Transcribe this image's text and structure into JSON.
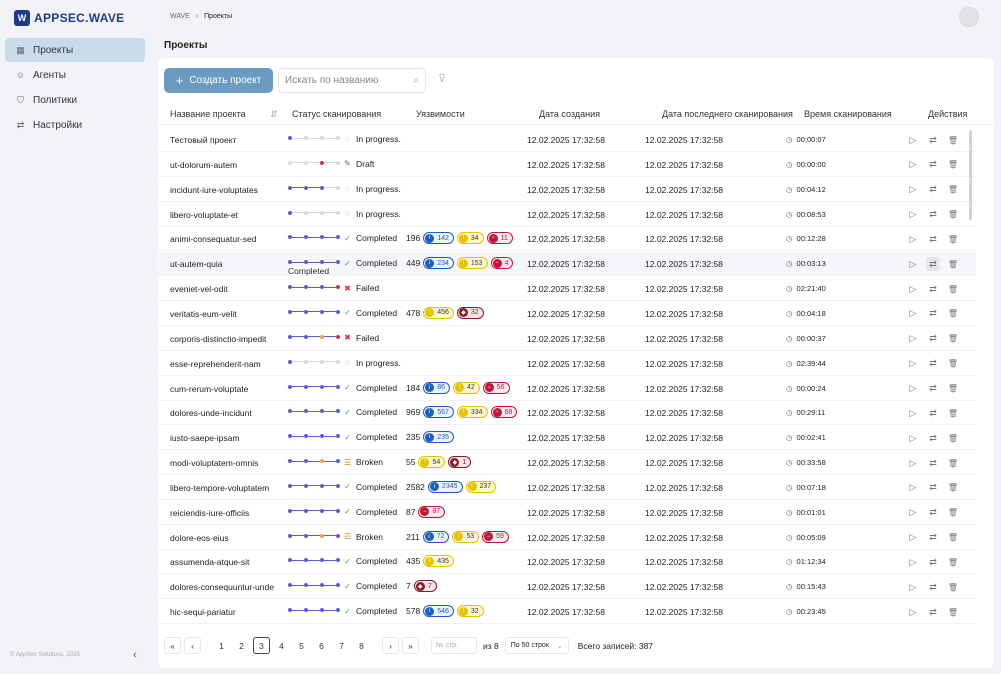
{
  "app": {
    "logo_mark": "W",
    "logo_text": "APPSEC.WAVE"
  },
  "sidebar": {
    "items": [
      {
        "label": "Проекты",
        "icon": "grid-icon",
        "glyph": "▦"
      },
      {
        "label": "Агенты",
        "icon": "agent-icon",
        "glyph": "☺"
      },
      {
        "label": "Политики",
        "icon": "shield-icon",
        "glyph": "⛉"
      },
      {
        "label": "Настройки",
        "icon": "sliders-icon",
        "glyph": "⇄"
      }
    ],
    "copyright": "© AppSec Solutions, 2025",
    "collapse_glyph": "‹"
  },
  "breadcrumb": {
    "root": "WAVE",
    "separator": "›",
    "current": "Проекты"
  },
  "page_title": "Проекты",
  "toolbar": {
    "create_label": "Создать проект",
    "create_glyph": "+",
    "search_placeholder": "Искать по названию",
    "search_glyph": "⌕",
    "filter_glyph": "⊽"
  },
  "table": {
    "headers": {
      "name": "Название проекта",
      "sort_glyph": "⇵",
      "status": "Статус сканирования",
      "vulns": "Уязвимости",
      "created": "Дата создания",
      "last_scan": "Дата последнего сканирования",
      "scan_time": "Время сканирования",
      "actions": "Действия"
    },
    "rows": [
      {
        "name": "Тестовый проект",
        "pipe": [
          "b",
          "g",
          "g",
          "g"
        ],
        "status": "In progress.",
        "kind": "progress",
        "count": "",
        "badges": [],
        "created": "12.02.2025 17:32:58",
        "last": "12.02.2025 17:32:58",
        "time": "00:00:07"
      },
      {
        "name": "ut-dolorum-autem",
        "pipe": [
          "g",
          "g",
          "r",
          "g"
        ],
        "status": "Draft",
        "kind": "draft",
        "count": "",
        "badges": [],
        "created": "12.02.2025 17:32:58",
        "last": "12.02.2025 17:32:58",
        "time": "00:00:00"
      },
      {
        "name": "incidunt-iure-voluptates",
        "pipe": [
          "b",
          "b",
          "b",
          "g"
        ],
        "status": "In progress.",
        "kind": "progress",
        "count": "",
        "badges": [],
        "created": "12.02.2025 17:32:58",
        "last": "12.02.2025 17:32:58",
        "time": "00:04:12"
      },
      {
        "name": "libero-voluptate-et",
        "pipe": [
          "b",
          "g",
          "g",
          "g"
        ],
        "status": "In progress.",
        "kind": "progress",
        "count": "",
        "badges": [],
        "created": "12.02.2025 17:32:58",
        "last": "12.02.2025 17:32:58",
        "time": "00:08:53"
      },
      {
        "name": "animi-consequatur-sed",
        "pipe": [
          "b",
          "b",
          "b",
          "b"
        ],
        "status": "Completed",
        "kind": "ok",
        "count": "196",
        "badges": [
          {
            "t": "info",
            "v": "142"
          },
          {
            "t": "warn",
            "v": "34"
          },
          {
            "t": "crit",
            "v": "11"
          }
        ],
        "created": "12.02.2025 17:32:58",
        "last": "12.02.2025 17:32:58",
        "time": "00:12:28"
      },
      {
        "name": "ut-autem-quia",
        "pipe": [
          "b",
          "b",
          "b",
          "b"
        ],
        "status": "Completed",
        "kind": "ok",
        "count": "449",
        "badges": [
          {
            "t": "info",
            "v": "234"
          },
          {
            "t": "warn",
            "v": "153"
          },
          {
            "t": "crit",
            "v": "4"
          }
        ],
        "created": "12.02.2025 17:32:58",
        "last": "12.02.2025 17:32:58",
        "time": "00:03:13",
        "hl": true
      },
      {
        "name": "eveniet-vel-odit",
        "pipe": [
          "b",
          "b",
          "b",
          "r"
        ],
        "status": "Failed",
        "kind": "fail",
        "count": "",
        "badges": [],
        "created": "12.02.2025 17:32:58",
        "last": "12.02.2025 17:32:58",
        "time": "02:21:40"
      },
      {
        "name": "veritatis-eum-velit",
        "pipe": [
          "b",
          "b",
          "b",
          "b"
        ],
        "status": "Completed",
        "kind": "ok",
        "count": "478",
        "badges": [
          {
            "t": "warn",
            "v": "456"
          },
          {
            "t": "high",
            "v": "32"
          }
        ],
        "created": "12.02.2025 17:32:58",
        "last": "12.02.2025 17:32:58",
        "time": "00:04:18"
      },
      {
        "name": "corporis-distinctio-impedit",
        "pipe": [
          "b",
          "b",
          "o",
          "r"
        ],
        "status": "Failed",
        "kind": "fail",
        "count": "",
        "badges": [],
        "created": "12.02.2025 17:32:58",
        "last": "12.02.2025 17:32:58",
        "time": "00:00:37"
      },
      {
        "name": "esse-reprehenderit-nam",
        "pipe": [
          "b",
          "g",
          "g",
          "g"
        ],
        "status": "In progress.",
        "kind": "progress",
        "count": "",
        "badges": [],
        "created": "12.02.2025 17:32:58",
        "last": "12.02.2025 17:32:58",
        "time": "02:39:44"
      },
      {
        "name": "cum-rerum-voluptate",
        "pipe": [
          "b",
          "b",
          "b",
          "b"
        ],
        "status": "Completed",
        "kind": "ok",
        "count": "184",
        "badges": [
          {
            "t": "info",
            "v": "86"
          },
          {
            "t": "warn",
            "v": "42"
          },
          {
            "t": "crit",
            "v": "56"
          }
        ],
        "created": "12.02.2025 17:32:58",
        "last": "12.02.2025 17:32:58",
        "time": "00:00:24"
      },
      {
        "name": "dolores-unde-incidunt",
        "pipe": [
          "b",
          "b",
          "b",
          "b"
        ],
        "status": "Completed",
        "kind": "ok",
        "count": "969",
        "badges": [
          {
            "t": "info",
            "v": "567"
          },
          {
            "t": "warn",
            "v": "334"
          },
          {
            "t": "crit",
            "v": "68"
          }
        ],
        "created": "12.02.2025 17:32:58",
        "last": "12.02.2025 17:32:58",
        "time": "00:29:11"
      },
      {
        "name": "iusto-saepe-ipsam",
        "pipe": [
          "b",
          "b",
          "b",
          "b"
        ],
        "status": "Completed",
        "kind": "ok",
        "count": "235",
        "badges": [
          {
            "t": "info",
            "v": "235"
          }
        ],
        "created": "12.02.2025 17:32:58",
        "last": "12.02.2025 17:32:58",
        "time": "00:02:41"
      },
      {
        "name": "modi-voluptatem-omnis",
        "pipe": [
          "b",
          "b",
          "o",
          "b"
        ],
        "status": "Broken",
        "kind": "broken",
        "count": "55",
        "badges": [
          {
            "t": "warn",
            "v": "54"
          },
          {
            "t": "high",
            "v": "1"
          }
        ],
        "created": "12.02.2025 17:32:58",
        "last": "12.02.2025 17:32:58",
        "time": "00:33:58"
      },
      {
        "name": "libero-tempore-voluptatem",
        "pipe": [
          "b",
          "b",
          "b",
          "b"
        ],
        "status": "Completed",
        "kind": "ok",
        "count": "2582",
        "badges": [
          {
            "t": "info",
            "v": "2345"
          },
          {
            "t": "warn",
            "v": "237"
          }
        ],
        "created": "12.02.2025 17:32:58",
        "last": "12.02.2025 17:32:58",
        "time": "00:07:18"
      },
      {
        "name": "reiciendis-iure-officiis",
        "pipe": [
          "b",
          "b",
          "b",
          "b"
        ],
        "status": "Completed",
        "kind": "ok",
        "count": "87",
        "badges": [
          {
            "t": "crit",
            "v": "87"
          }
        ],
        "created": "12.02.2025 17:32:58",
        "last": "12.02.2025 17:32:58",
        "time": "00:01:01"
      },
      {
        "name": "dolore-eos-eius",
        "pipe": [
          "b",
          "b",
          "o",
          "b"
        ],
        "status": "Broken",
        "kind": "broken",
        "count": "211",
        "badges": [
          {
            "t": "info",
            "v": "72"
          },
          {
            "t": "warn",
            "v": "53"
          },
          {
            "t": "crit",
            "v": "59"
          }
        ],
        "created": "12.02.2025 17:32:58",
        "last": "12.02.2025 17:32:58",
        "time": "00:05:09"
      },
      {
        "name": "assumenda-atque-sit",
        "pipe": [
          "b",
          "b",
          "b",
          "b"
        ],
        "status": "Completed",
        "kind": "ok",
        "count": "435",
        "badges": [
          {
            "t": "warn",
            "v": "435"
          }
        ],
        "created": "12.02.2025 17:32:58",
        "last": "12.02.2025 17:32:58",
        "time": "01:12:34"
      },
      {
        "name": "dolores-consequuntur-unde",
        "pipe": [
          "b",
          "b",
          "b",
          "b"
        ],
        "status": "Completed",
        "kind": "ok",
        "count": "7",
        "badges": [
          {
            "t": "high",
            "v": "7"
          }
        ],
        "created": "12.02.2025 17:32:58",
        "last": "12.02.2025 17:32:58",
        "time": "00:15:43"
      },
      {
        "name": "hic-sequi-pariatur",
        "pipe": [
          "b",
          "b",
          "b",
          "b"
        ],
        "status": "Completed",
        "kind": "ok",
        "count": "578",
        "badges": [
          {
            "t": "info",
            "v": "546"
          },
          {
            "t": "warn",
            "v": "32"
          }
        ],
        "created": "12.02.2025 17:32:58",
        "last": "12.02.2025 17:32:58",
        "time": "00:23:45"
      }
    ],
    "tooltip": "Completed"
  },
  "status_glyphs": {
    "progress": "◌",
    "draft": "✎",
    "ok": "✓",
    "fail": "✖",
    "broken": "☰"
  },
  "status_colors": {
    "progress": "#1d5fbf",
    "draft": "#666666",
    "ok": "#3aa84a",
    "fail": "#d0324a",
    "broken": "#e08a1e"
  },
  "pipe_colors": {
    "b": "#5b5bd6",
    "g": "#d8dadf",
    "r": "#d0324a",
    "o": "#f0a040"
  },
  "icon_glyphs": {
    "clock": "◷",
    "info": "i",
    "warn": "!",
    "crit": "−",
    "high": "◆"
  },
  "actions": {
    "run_glyph": "▷",
    "swap_glyph": "⇄",
    "delete_glyph": "🗑"
  },
  "pagination": {
    "first": "«",
    "prev": "‹",
    "next": "›",
    "last": "»",
    "pages": [
      "1",
      "2",
      "3",
      "4",
      "5",
      "6",
      "7",
      "8"
    ],
    "current": "3",
    "page_input_placeholder": "№ стр.",
    "of_total": "из 8",
    "per_page": "По 50 строк",
    "per_page_chevron": "⌄",
    "total_records": "Всего записей: 387"
  }
}
